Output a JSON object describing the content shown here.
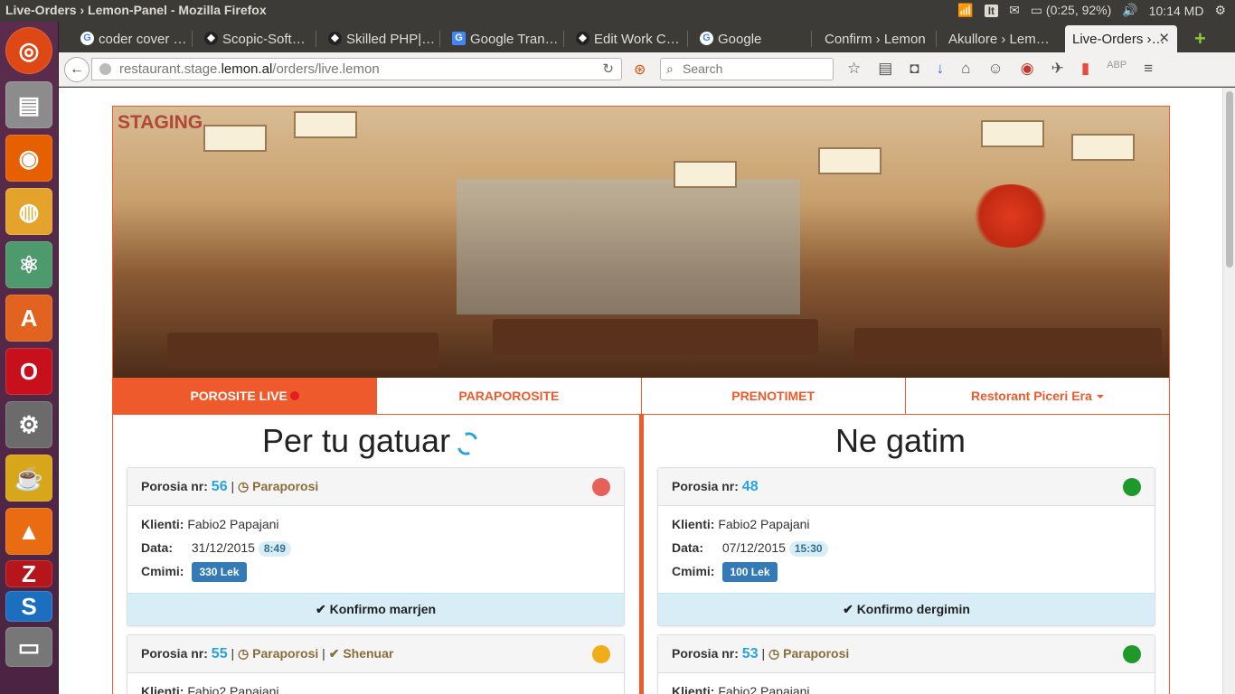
{
  "window": {
    "title": "Live-Orders › Lemon-Panel - Mozilla Firefox",
    "tray": {
      "lang": "It",
      "battery": "(0:25, 92%)",
      "time": "10:14 MD"
    }
  },
  "launcher": {
    "items": [
      "ubuntu-icon",
      "files-icon",
      "firefox-icon",
      "chrome-icon",
      "atom-icon",
      "software-center-icon",
      "opera-icon",
      "settings-icon",
      "teapot-icon",
      "vlc-icon",
      "filezilla-icon",
      "skype-icon",
      "scanner-icon"
    ]
  },
  "tabs": [
    {
      "label": "coder cover …",
      "icon": "google-icon"
    },
    {
      "label": "Scopic-Soft…",
      "icon": "upwork-icon"
    },
    {
      "label": "Skilled PHP|…",
      "icon": "upwork-icon"
    },
    {
      "label": "Google Tran…",
      "icon": "translate-icon"
    },
    {
      "label": "Edit Work C…",
      "icon": "upwork-icon"
    },
    {
      "label": "Google",
      "icon": "google-icon"
    },
    {
      "label": "Confirm › Lemon",
      "icon": ""
    },
    {
      "label": "Akullore › Lem…",
      "icon": ""
    },
    {
      "label": "Live-Orders ›…",
      "icon": "",
      "active": true
    }
  ],
  "urlbar": {
    "prefix": "restaurant.stage.",
    "host": "lemon.al",
    "path": "/orders/live.lemon"
  },
  "search": {
    "placeholder": "Search"
  },
  "page": {
    "staging": "STAGING",
    "nav": {
      "live": "POROSITE LIVE",
      "paraporosite": "PARAPOROSITE",
      "prenotimet": "PRENOTIMET",
      "restaurant": "Restorant Piceri Era"
    },
    "left": {
      "heading": "Per tu gatuar",
      "cards": [
        {
          "label": "Porosia nr:",
          "nr": "56",
          "tag": "Paraporosi",
          "extra": "",
          "status": "#e8605a",
          "client_label": "Klienti:",
          "client": "Fabio2 Papajani",
          "date_label": "Data:",
          "date": "31/12/2015",
          "time": "8:49",
          "price_label": "Cmimi:",
          "price": "330 Lek",
          "action": "Konfirmo marrjen"
        },
        {
          "label": "Porosia nr:",
          "nr": "55",
          "tag": "Paraporosi",
          "extra": "Shenuar",
          "status": "#f0ad17",
          "client_label": "Klienti:",
          "client": "Fabio2 Papajani"
        }
      ]
    },
    "right": {
      "heading": "Ne gatim",
      "cards": [
        {
          "label": "Porosia nr:",
          "nr": "48",
          "status": "#1f9a2a",
          "client_label": "Klienti:",
          "client": "Fabio2 Papajani",
          "date_label": "Data:",
          "date": "07/12/2015",
          "time": "15:30",
          "price_label": "Cmimi:",
          "price": "100 Lek",
          "action": "Konfirmo dergimin"
        },
        {
          "label": "Porosia nr:",
          "nr": "53",
          "tag": "Paraporosi",
          "status": "#1f9a2a",
          "client_label": "Klienti:",
          "client": "Fabio2 Papajani"
        }
      ]
    }
  }
}
